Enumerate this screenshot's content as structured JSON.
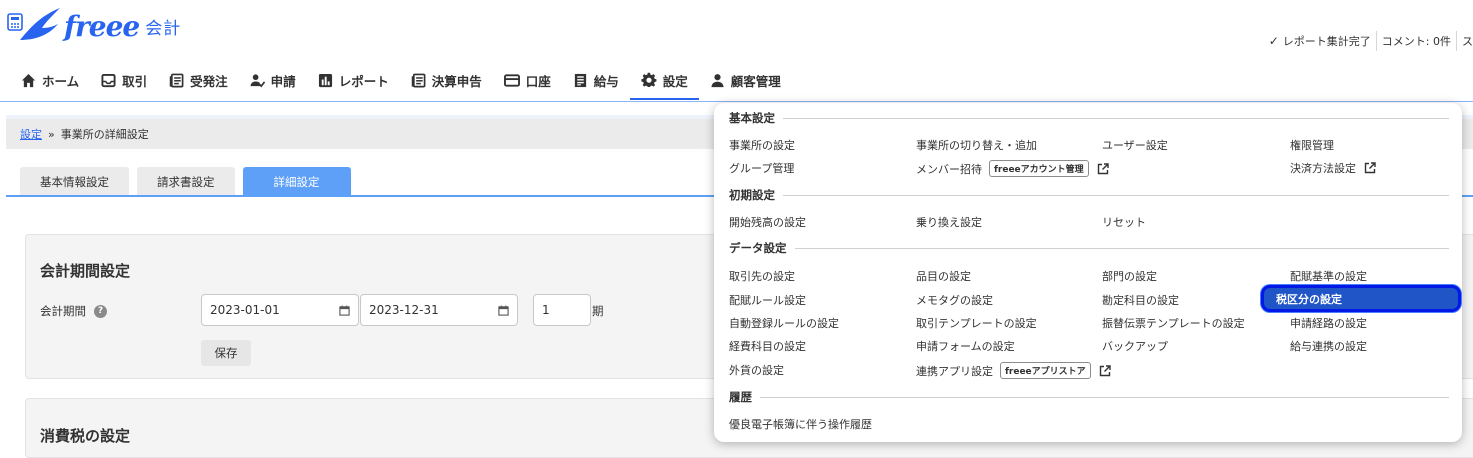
{
  "app": {
    "logo_word": "freee",
    "logo_suffix": "会計"
  },
  "status": {
    "report": "レポート集計完了",
    "comment": "コメント: 0件",
    "overflow": "ス"
  },
  "nav": [
    {
      "label": "ホーム",
      "icon": "home-icon"
    },
    {
      "label": "取引",
      "icon": "tray-icon"
    },
    {
      "label": "受発注",
      "icon": "document-stack-icon"
    },
    {
      "label": "申請",
      "icon": "user-check-icon"
    },
    {
      "label": "レポート",
      "icon": "bar-chart-icon"
    },
    {
      "label": "決算申告",
      "icon": "document-stack-icon"
    },
    {
      "label": "口座",
      "icon": "card-icon"
    },
    {
      "label": "給与",
      "icon": "receipt-icon"
    },
    {
      "label": "設定",
      "icon": "gear-icon",
      "active": true
    },
    {
      "label": "顧客管理",
      "icon": "user-icon"
    }
  ],
  "breadcrumb": {
    "link": "設定",
    "current": "事業所の詳細設定"
  },
  "tabs": [
    "基本情報設定",
    "請求書設定",
    "詳細設定"
  ],
  "fiscal": {
    "title": "会計期間設定",
    "label": "会計期間",
    "start": "2023-01-01",
    "end": "2023-12-31",
    "period": "1",
    "period_suffix": "期",
    "save": "保存"
  },
  "tax": {
    "title": "消費税の設定"
  },
  "menu": {
    "basic": {
      "title": "基本設定",
      "office": "事業所の設定",
      "switch": "事業所の切り替え・追加",
      "user": "ユーザー設定",
      "permission": "権限管理",
      "group": "グループ管理",
      "invite": "メンバー招待",
      "invite_badge": "freeeアカウント管理",
      "payment": "決済方法設定"
    },
    "initial": {
      "title": "初期設定",
      "opening": "開始残高の設定",
      "migration": "乗り換え設定",
      "reset": "リセット"
    },
    "data": {
      "title": "データ設定",
      "partner": "取引先の設定",
      "item": "品目の設定",
      "dept": "部門の設定",
      "alloc_base": "配賦基準の設定",
      "alloc_rule": "配賦ルール設定",
      "memo": "メモタグの設定",
      "account": "勘定科目の設定",
      "tax_class": "税区分の設定",
      "auto_rule": "自動登録ルールの設定",
      "deal_tpl": "取引テンプレートの設定",
      "transfer_tpl": "振替伝票テンプレートの設定",
      "route": "申請経路の設定",
      "expense": "経費科目の設定",
      "form": "申請フォームの設定",
      "backup": "バックアップ",
      "payroll": "給与連携の設定",
      "currency": "外貨の設定",
      "app": "連携アプリ設定",
      "app_badge": "freeeアプリストア"
    },
    "history": {
      "title": "履歴",
      "log": "優良電子帳簿に伴う操作履歴"
    }
  },
  "colors": {
    "brand": "#2864f0",
    "tab_active": "#5ea0f8",
    "highlight": "#1f55c7"
  }
}
